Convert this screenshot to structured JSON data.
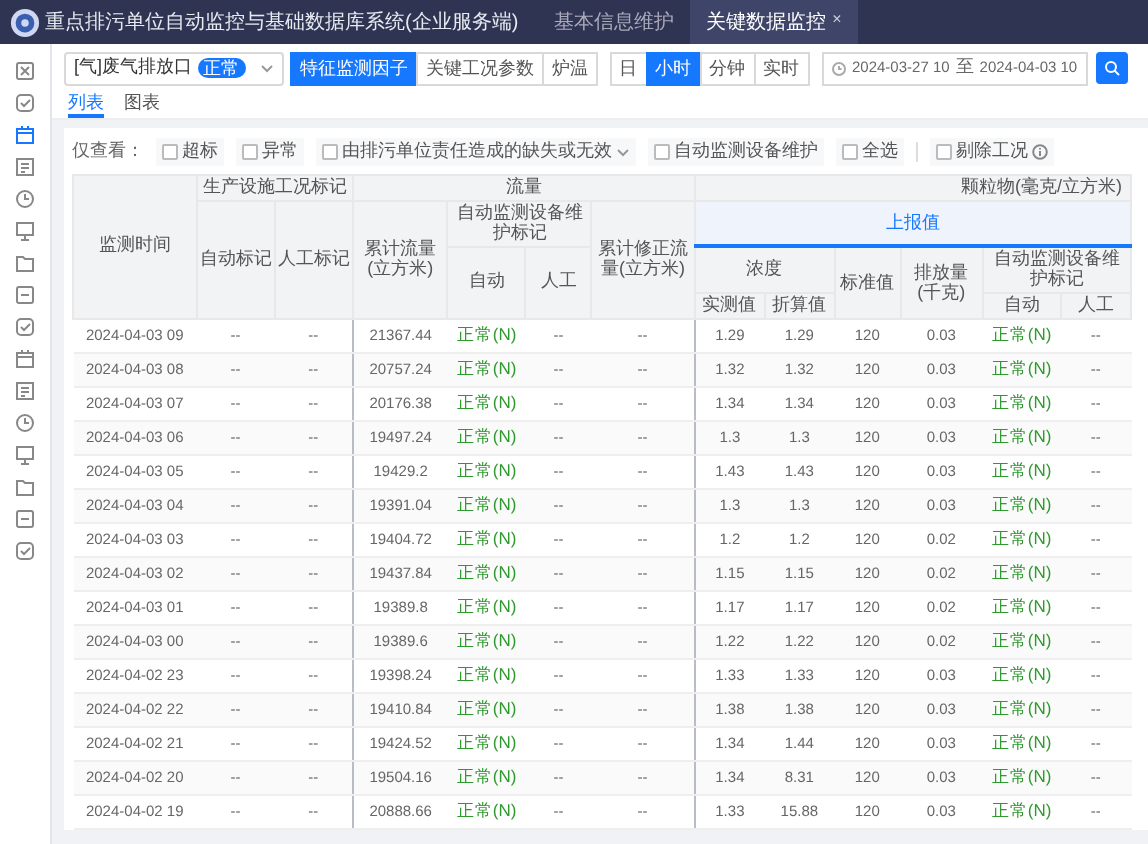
{
  "window": {
    "title": "重点排污单位自动监控与基础数据库系统(企业服务端)",
    "tabs": [
      {
        "label": "基本信息维护",
        "selected": false
      },
      {
        "label": "关键数据监控",
        "selected": true,
        "close": "×"
      }
    ]
  },
  "sidebar": {
    "items": [
      {
        "selected": false
      },
      {
        "selected": false
      },
      {
        "selected": true
      },
      {
        "selected": false
      },
      {
        "selected": false
      },
      {
        "selected": false
      },
      {
        "selected": false
      },
      {
        "selected": false
      },
      {
        "selected": false
      },
      {
        "selected": false
      },
      {
        "selected": false
      },
      {
        "selected": false
      },
      {
        "selected": false
      },
      {
        "selected": false
      },
      {
        "selected": false
      },
      {
        "selected": false
      }
    ]
  },
  "toolbar": {
    "outlet": {
      "label": "[气]废气排放口",
      "status": "正常"
    },
    "factor_buttons": [
      {
        "label": "特征监测因子",
        "selected": true
      },
      {
        "label": "关键工况参数",
        "selected": false
      },
      {
        "label": "炉温",
        "selected": false
      }
    ],
    "period_buttons": [
      {
        "label": "日",
        "selected": false
      },
      {
        "label": "小时",
        "selected": true
      },
      {
        "label": "分钟",
        "selected": false
      },
      {
        "label": "实时",
        "selected": false
      }
    ],
    "date_range": {
      "start": "2024-03-27 10",
      "separator": "至",
      "end": "2024-04-03 10"
    }
  },
  "view_tabs": [
    {
      "label": "列表",
      "selected": true
    },
    {
      "label": "图表",
      "selected": false
    }
  ],
  "filters": {
    "label": "仅查看：",
    "options": [
      {
        "label": "超标",
        "checked": false,
        "kind": "checkbox"
      },
      {
        "label": "异常",
        "checked": false,
        "kind": "checkbox"
      },
      {
        "label": "由排污单位责任造成的缺失或无效",
        "checked": false,
        "kind": "dropdown"
      },
      {
        "label": "自动监测设备维护",
        "checked": false,
        "kind": "checkbox"
      },
      {
        "label": "全选",
        "checked": false,
        "kind": "checkbox"
      }
    ],
    "exclude": {
      "label": "剔除工况",
      "checked": false
    }
  },
  "table": {
    "header_rows": [
      [
        {
          "label": "监测时间",
          "rowspan": 4
        },
        {
          "label": "生产设施工况标记",
          "colspan": 2
        },
        {
          "label": "流量",
          "colspan": 4
        },
        {
          "label": "颗粒物(毫克/立方米)",
          "colspan": 6
        }
      ],
      [
        {
          "label": "自动标记",
          "rowspan": 3
        },
        {
          "label": "人工标记",
          "rowspan": 3
        },
        {
          "label": "累计流量(立方米)",
          "rowspan": 3
        },
        {
          "label": "自动监测设备维护标记",
          "colspan": 2
        },
        {
          "label": "累计修正流量(立方米)",
          "rowspan": 3
        },
        {
          "label": "上报值",
          "colspan": 6,
          "highlight": true
        }
      ],
      [
        {
          "label": "自动",
          "rowspan": 2
        },
        {
          "label": "人工",
          "rowspan": 2
        },
        {
          "label": "浓度",
          "colspan": 2
        },
        {
          "label": "标准值",
          "rowspan": 2
        },
        {
          "label": "排放量(千克)",
          "rowspan": 2
        },
        {
          "label": "自动监测设备维护标记",
          "colspan": 2
        }
      ],
      [
        {
          "label": "实测值"
        },
        {
          "label": "折算值"
        },
        {
          "label": "自动"
        },
        {
          "label": "人工"
        }
      ]
    ],
    "rows": [
      [
        "2024-04-03 09",
        "--",
        "--",
        "21367.44",
        {
          "text": "正常(N)",
          "kind": "status"
        },
        "--",
        "--",
        "1.29",
        "1.29",
        "120",
        "0.03",
        {
          "text": "正常(N)",
          "kind": "status"
        },
        "--"
      ],
      [
        "2024-04-03 08",
        "--",
        "--",
        "20757.24",
        {
          "text": "正常(N)",
          "kind": "status"
        },
        "--",
        "--",
        "1.32",
        "1.32",
        "120",
        "0.03",
        {
          "text": "正常(N)",
          "kind": "status"
        },
        "--"
      ],
      [
        "2024-04-03 07",
        "--",
        "--",
        "20176.38",
        {
          "text": "正常(N)",
          "kind": "status"
        },
        "--",
        "--",
        "1.34",
        "1.34",
        "120",
        "0.03",
        {
          "text": "正常(N)",
          "kind": "status"
        },
        "--"
      ],
      [
        "2024-04-03 06",
        "--",
        "--",
        "19497.24",
        {
          "text": "正常(N)",
          "kind": "status"
        },
        "--",
        "--",
        "1.3",
        "1.3",
        "120",
        "0.03",
        {
          "text": "正常(N)",
          "kind": "status"
        },
        "--"
      ],
      [
        "2024-04-03 05",
        "--",
        "--",
        "19429.2",
        {
          "text": "正常(N)",
          "kind": "status"
        },
        "--",
        "--",
        "1.43",
        "1.43",
        "120",
        "0.03",
        {
          "text": "正常(N)",
          "kind": "status"
        },
        "--"
      ],
      [
        "2024-04-03 04",
        "--",
        "--",
        "19391.04",
        {
          "text": "正常(N)",
          "kind": "status"
        },
        "--",
        "--",
        "1.3",
        "1.3",
        "120",
        "0.03",
        {
          "text": "正常(N)",
          "kind": "status"
        },
        "--"
      ],
      [
        "2024-04-03 03",
        "--",
        "--",
        "19404.72",
        {
          "text": "正常(N)",
          "kind": "status"
        },
        "--",
        "--",
        "1.2",
        "1.2",
        "120",
        "0.02",
        {
          "text": "正常(N)",
          "kind": "status"
        },
        "--"
      ],
      [
        "2024-04-03 02",
        "--",
        "--",
        "19437.84",
        {
          "text": "正常(N)",
          "kind": "status"
        },
        "--",
        "--",
        "1.15",
        "1.15",
        "120",
        "0.02",
        {
          "text": "正常(N)",
          "kind": "status"
        },
        "--"
      ],
      [
        "2024-04-03 01",
        "--",
        "--",
        "19389.8",
        {
          "text": "正常(N)",
          "kind": "status"
        },
        "--",
        "--",
        "1.17",
        "1.17",
        "120",
        "0.02",
        {
          "text": "正常(N)",
          "kind": "status"
        },
        "--"
      ],
      [
        "2024-04-03 00",
        "--",
        "--",
        "19389.6",
        {
          "text": "正常(N)",
          "kind": "status"
        },
        "--",
        "--",
        "1.22",
        "1.22",
        "120",
        "0.02",
        {
          "text": "正常(N)",
          "kind": "status"
        },
        "--"
      ],
      [
        "2024-04-02 23",
        "--",
        "--",
        "19398.24",
        {
          "text": "正常(N)",
          "kind": "status"
        },
        "--",
        "--",
        "1.33",
        "1.33",
        "120",
        "0.03",
        {
          "text": "正常(N)",
          "kind": "status"
        },
        "--"
      ],
      [
        "2024-04-02 22",
        "--",
        "--",
        "19410.84",
        {
          "text": "正常(N)",
          "kind": "status"
        },
        "--",
        "--",
        "1.38",
        "1.38",
        "120",
        "0.03",
        {
          "text": "正常(N)",
          "kind": "status"
        },
        "--"
      ],
      [
        "2024-04-02 21",
        "--",
        "--",
        "19424.52",
        {
          "text": "正常(N)",
          "kind": "status"
        },
        "--",
        "--",
        "1.34",
        "1.44",
        "120",
        "0.03",
        {
          "text": "正常(N)",
          "kind": "status"
        },
        "--"
      ],
      [
        "2024-04-02 20",
        "--",
        "--",
        "19504.16",
        {
          "text": "正常(N)",
          "kind": "status"
        },
        "--",
        "--",
        "1.34",
        "8.31",
        "120",
        "0.03",
        {
          "text": "正常(N)",
          "kind": "status"
        },
        "--"
      ],
      [
        "2024-04-02 19",
        "--",
        "--",
        "20888.66",
        {
          "text": "正常(N)",
          "kind": "status"
        },
        "--",
        "--",
        "1.33",
        "15.88",
        "120",
        "0.03",
        {
          "text": "正常(N)",
          "kind": "status"
        },
        "--"
      ]
    ]
  }
}
